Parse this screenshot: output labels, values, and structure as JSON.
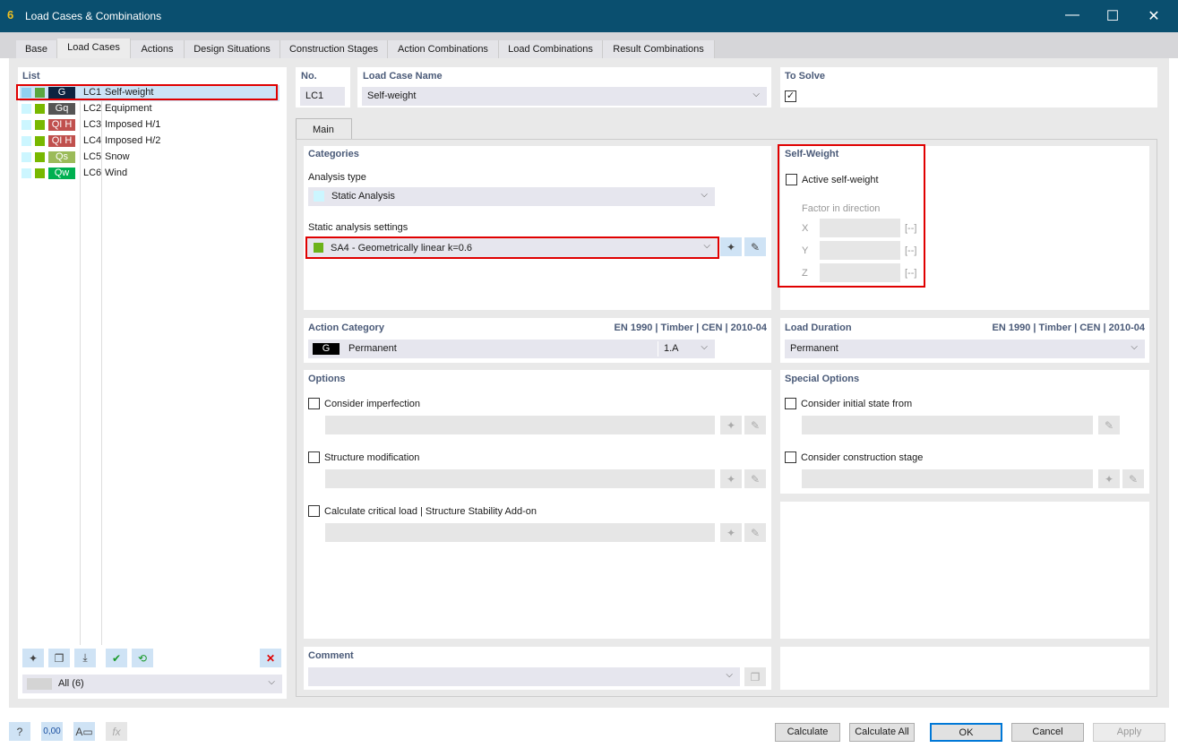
{
  "window": {
    "title": "Load Cases & Combinations",
    "minimize": "—",
    "maximize": "☐",
    "close": "✕"
  },
  "tabs": [
    "Base",
    "Load Cases",
    "Actions",
    "Design Situations",
    "Construction Stages",
    "Action Combinations",
    "Load Combinations",
    "Result Combinations"
  ],
  "list": {
    "header": "List",
    "items": [
      {
        "badge": "G",
        "badge_color": "#0d2340",
        "id": "LC1",
        "name": "Self-weight"
      },
      {
        "badge": "Gq",
        "badge_color": "#555555",
        "id": "LC2",
        "name": "Equipment"
      },
      {
        "badge": "QI H",
        "badge_color": "#c0504d",
        "id": "LC3",
        "name": "Imposed H/1"
      },
      {
        "badge": "QI H",
        "badge_color": "#c0504d",
        "id": "LC4",
        "name": "Imposed H/2"
      },
      {
        "badge": "Qs",
        "badge_color": "#9bbb59",
        "id": "LC5",
        "name": "Snow"
      },
      {
        "badge": "Qw",
        "badge_color": "#00b050",
        "id": "LC6",
        "name": "Wind"
      }
    ],
    "filter": "All (6)"
  },
  "header": {
    "no_label": "No.",
    "no_value": "LC1",
    "name_label": "Load Case Name",
    "name_value": "Self-weight",
    "to_solve_label": "To Solve"
  },
  "main_tab": "Main",
  "categories": {
    "title": "Categories",
    "analysis_type_label": "Analysis type",
    "analysis_type": "Static Analysis",
    "settings_label": "Static analysis settings",
    "settings_value": "SA4 - Geometrically linear k=0.6"
  },
  "self_weight": {
    "title": "Self-Weight",
    "active_label": "Active self-weight",
    "factor_label": "Factor in direction",
    "axes": [
      "X",
      "Y",
      "Z"
    ],
    "unit": "[--]"
  },
  "action_category": {
    "title": "Action Category",
    "standard": "EN 1990 | Timber | CEN | 2010-04",
    "badge": "G",
    "value": "Permanent",
    "code": "1.A"
  },
  "load_duration": {
    "title": "Load Duration",
    "standard": "EN 1990 | Timber | CEN | 2010-04",
    "value": "Permanent"
  },
  "options": {
    "title": "Options",
    "items": [
      "Consider imperfection",
      "Structure modification",
      "Calculate critical load | Structure Stability Add-on"
    ]
  },
  "special_options": {
    "title": "Special Options",
    "items": [
      "Consider initial state from",
      "Consider construction stage"
    ]
  },
  "comment": {
    "title": "Comment"
  },
  "buttons": {
    "calculate": "Calculate",
    "calculate_all": "Calculate All",
    "ok": "OK",
    "cancel": "Cancel",
    "apply": "Apply"
  }
}
